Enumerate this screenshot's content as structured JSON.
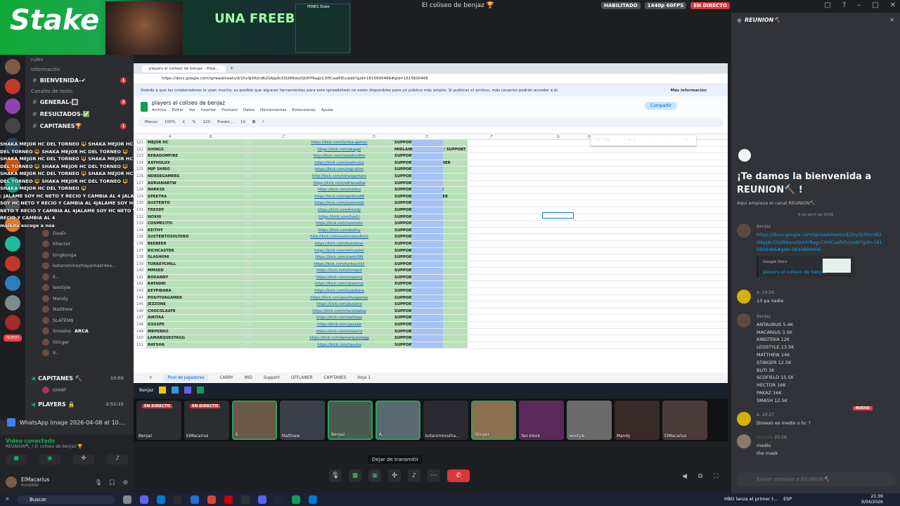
{
  "window": {
    "title": "El coliseo de benjaz 🏆",
    "badges": [
      "HABILITADO",
      "1440p 60FPS",
      "EN DIRECTO"
    ],
    "badge_colors": [
      "#4e5058",
      "#4e5058",
      "#da373c"
    ]
  },
  "banner": {
    "brand": "Stake",
    "promo": "UNA FREEBET",
    "mini_label": "PENES Stake"
  },
  "sidebar": {
    "category_rules": "rules",
    "category_info": "Información",
    "ch_bienvenida": "BIENVENIDA-✔",
    "category_text": "Canales de texto",
    "ch_general": "GENERAL-🔳",
    "ch_resultados": "RESULTADOS-✅",
    "ch_capitanes": "CAPITANES🏆",
    "voice_users": [
      "DaaD-",
      "Khector",
      "kingkonga",
      "kotarominozhayamasr4ev...",
      "K..",
      "leostyle",
      "Mandy",
      "Matthew",
      "SLATEM$",
      "Smasho",
      "Stinger",
      "V.."
    ],
    "smasho_tag": "ARCA",
    "ch_capitanes2": "CAPITANES 🔨",
    "capitanes2_time": "15:55",
    "ghiat": "GHIAT",
    "ch_players": "PLAYERS 🔒",
    "players_time": "2:52:15",
    "new_badge": "NUEVO"
  },
  "overlay_chat": [
    "SHAKA MEJOR HC DEL TORNEO 🔱 SHAKA MEJOR HC",
    "DEL TORNEO 🔱 SHAKA MEJOR HC DEL TORNEO 🔱",
    "SHAKA MEJOR HC DEL TORNEO 🔱 SHAKA MEJOR HC",
    "DEL TORNEO 🔱 SHAKA MEJOR HC DEL TORNEO 🔱",
    "SHAKA MEJOR HC DEL TORNEO 🔱 SHAKA MEJOR HC",
    "DEL TORNEO 🔱 SHAKA MEJOR HC DEL TORNEO 🔱",
    "SHAKA MEJOR HC DEL TORNEO 🔱",
    ": JALAME SOY HC NETO Y RECIO Y CAMBIA AL 4 JALAME",
    "SOY HC NETO Y RECIO Y CAMBIA AL 4JALAME SOY HC",
    "NETO Y RECIO Y CAMBIA AL 4JALAME SOY HC NETO Y",
    "RECIO Y CAMBIA AL 4",
    "maikita escoge a noa"
  ],
  "whatsapp": "WhatsApp Image 2026-04-08 at 10....",
  "voice": {
    "status": "Video conectado",
    "channel": "REUNION🔨 / El coliseo de benjaz 🏆"
  },
  "user": {
    "name": "ElMacarius",
    "status": "Invisible"
  },
  "browser": {
    "tab": "players el coliseo de benjaz - Hoja...",
    "url": "https://docs.google.com/spreadsheets/d/1hy9jXRzrzB2OAJq9c5SQR6oozQUHYRagcCXHCaafH5c/edit?gid=1615600466#gid=1615600466",
    "info": "Debido a que los colaboradores lo usan mucho, es posible que algunas herramientas para este spreadsheet no estén disponibles para un público más amplio. Si publicas el archivo, más usuarios podrán acceder a él.",
    "more_info": "Más información"
  },
  "doc": {
    "title": "players el coliseo de benjaz",
    "menus": [
      "Archivo",
      "Editar",
      "Ver",
      "Insertar",
      "Formato",
      "Datos",
      "Herramientas",
      "Extensiones",
      "Ayuda"
    ],
    "share": "Compartir",
    "toolbar": [
      "Menús",
      "100%",
      "€",
      "%",
      "123",
      "Predet...",
      "10",
      "B",
      "I"
    ],
    "find_query": "LA OGA",
    "find_count": "1 de 1",
    "columns": [
      "A",
      "B",
      "C",
      "D",
      "E",
      "F",
      "G",
      "H"
    ]
  },
  "sheet_rows": [
    {
      "n": "121",
      "name": "MEJOR HC",
      "pts": "3000",
      "link": "https://kick.com/lyrosa-games",
      "role": "SUPPORT"
    },
    {
      "n": "122",
      "name": "SHINGS",
      "pts": "5000",
      "link": "https://kick.com/akagal",
      "role": "MIDLANER / OFFLANER / SUPPORT"
    },
    {
      "n": "123",
      "name": "REBADOMFIRE",
      "pts": "3900",
      "link": "http://kick.com/rebadomfire",
      "role": "SUPPORT"
    },
    {
      "n": "124",
      "name": "XATHULUX",
      "pts": "3900",
      "link": "https://kick.com/xxathulux",
      "role": "SUPPORT 4 / 5 / OFFLANER"
    },
    {
      "n": "125",
      "name": "MJP SHIRO",
      "pts": "3800",
      "link": "https://kick.com/mjp-shiro",
      "role": "SUPPORT 5"
    },
    {
      "n": "126",
      "name": "NDREEGAMERS",
      "pts": "3800",
      "link": "http://kick.com/ndreegamers",
      "role": "SUPPORT"
    },
    {
      "n": "127",
      "name": "ADRIANABTW",
      "pts": "3800",
      "link": "https://kick.com/adrianabtw",
      "role": "SUPPORT 5"
    },
    {
      "n": "128",
      "name": "NARKSS",
      "pts": "3560",
      "link": "https://kick.com/narkss",
      "role": "SUPPORT 5 / OFFLANER"
    },
    {
      "n": "129",
      "name": "SPEKTRA",
      "pts": "3500",
      "link": "https://kick.com/spektra88",
      "role": "SUPPORT 4.5 / OFFLANER"
    },
    {
      "n": "130",
      "name": "SUSTENTO",
      "pts": "3500",
      "link": "https://kick.com/sustentob",
      "role": "SUPPORT 4 / 5"
    },
    {
      "n": "131",
      "name": "TREXDY",
      "pts": "3500",
      "link": "https://kick.com/trexdy",
      "role": "SUPPORT / MID"
    },
    {
      "n": "132",
      "name": "HOXHI",
      "pts": "3500",
      "link": "https://kick.com/hoxhi",
      "role": "SUPPORT"
    },
    {
      "n": "133",
      "name": "COSMECITO",
      "pts": "3500",
      "link": "https://kick.com/cosmetx",
      "role": "SUPPORT"
    },
    {
      "n": "134",
      "name": "KEITHY",
      "pts": "3500",
      "link": "https://kick.com/keithy",
      "role": "SUPPORT"
    },
    {
      "n": "135",
      "name": "SUSTENTOSOLTERO",
      "pts": "3500",
      "link": "http://kick.com/sustentosoltero",
      "role": "SUPPORT"
    },
    {
      "n": "136",
      "name": "BEEBEER",
      "pts": "3400",
      "link": "https://kick.com/beeebeer",
      "role": "SUPPORT 4 / 5"
    },
    {
      "n": "137",
      "name": "RICHCASTER",
      "pts": "3300",
      "link": "https://kick.com/richcaster",
      "role": "SUPPORT 4 / 5"
    },
    {
      "n": "138",
      "name": "SLASH096",
      "pts": "3200",
      "link": "https://kick.com/slash096",
      "role": "SUPPORT 4 / 5"
    },
    {
      "n": "139",
      "name": "TURKEYCHILL",
      "pts": "3100",
      "link": "https://kick.com/turkeychill",
      "role": "SUPPORT"
    },
    {
      "n": "140",
      "name": "MMAED",
      "pts": "3000",
      "link": "https://kick.com/mmaed",
      "role": "SUPPORT 5"
    },
    {
      "n": "141",
      "name": "ROXANNY",
      "pts": "3000",
      "link": "https://kick.com/roxanny",
      "role": "SUPPORT 5"
    },
    {
      "n": "142",
      "name": "RATADRI",
      "pts": "3000",
      "link": "https://kick.com/ratadrixd",
      "role": "SUPPORT"
    },
    {
      "n": "143",
      "name": "KEYPIBARA",
      "pts": "3000",
      "link": "https://kick.com/keypibara",
      "role": "SUPPORT"
    },
    {
      "n": "144",
      "name": "POSITIVAGAMER",
      "pts": "3000",
      "link": "https://kick.com/positivagamer",
      "role": "SUPPORT"
    },
    {
      "n": "145",
      "name": "JEZZONE",
      "pts": "3000",
      "link": "https://kick.com/jezzone",
      "role": "SUPPORT"
    },
    {
      "n": "146",
      "name": "CHOCOLAATE",
      "pts": "3000",
      "link": "https://kick.com/chocolaatee",
      "role": "SUPPORT"
    },
    {
      "n": "147",
      "name": "AWITAA",
      "pts": "2800",
      "link": "https://kick.com/awitaaa",
      "role": "SUPPORT 5"
    },
    {
      "n": "148",
      "name": "GSUSPE",
      "pts": "2700",
      "link": "https://kick.com/gsuspe",
      "role": "SUPPORT"
    },
    {
      "n": "149",
      "name": "MRPERRO",
      "pts": "2700",
      "link": "https://kick.com/mrperro",
      "role": "SUPPORT 4 / 5"
    },
    {
      "n": "150",
      "name": "LAMARQUESTAGG",
      "pts": "2500",
      "link": "https://kick.com/lamarquestagg",
      "role": "SUPPORT 4 / 5"
    },
    {
      "n": "151",
      "name": "RAYSHA",
      "pts": "2500",
      "link": "https://kick.com/raysha",
      "role": "SUPPORT"
    }
  ],
  "sheet_tabs": [
    "Pool de Jugadores",
    "CARRY",
    "MID",
    "Support",
    "OFFLANER",
    "CAPITANES",
    "Hoja 1"
  ],
  "inner_task": {
    "app": "Benjaz"
  },
  "participants": [
    {
      "name": "Benjaz",
      "live": "EN DIRECTO",
      "color": "#2b2d31"
    },
    {
      "name": "ElMacarius",
      "live": "EN DIRECTO",
      "color": "#2b2d31"
    },
    {
      "name": "K",
      "live": "",
      "color": "#6b5848"
    },
    {
      "name": "Matthew",
      "live": "",
      "color": "#3a3f48"
    },
    {
      "name": "Benjaz",
      "live": "",
      "color": "#4a5a52"
    },
    {
      "name": "A.",
      "live": "",
      "color": "#5a6a70"
    },
    {
      "name": "kotarominozha...",
      "live": "",
      "color": "#2a2a30"
    },
    {
      "name": "Stinger",
      "live": "",
      "color": "#8a7050"
    },
    {
      "name": "Yan block",
      "live": "",
      "color": "#5a2a5a"
    },
    {
      "name": "leostyle",
      "live": "",
      "color": "#6a6a6a"
    },
    {
      "name": "Mandy",
      "live": "",
      "color": "#3a2a2a"
    },
    {
      "name": "ElMacarius",
      "live": "",
      "color": "#4a3a3a"
    }
  ],
  "controls": {
    "tooltip": "Dejar de transmitir"
  },
  "chat": {
    "channel": "REUNION🔨",
    "welcome": "¡Te damos la bienvenida a REUNION🔨 !",
    "welcome_sub": "Aquí empieza el canal REUNION🔨.",
    "date": "9 de abril de 2026",
    "msg1_author": "Benjaz",
    "msg1_link": "https://docs.google.com/spreadsheets/d/1hy9jXRzrzB2OAJq9c5SQR6oozQUHYRagcCXHCaafH5c/edit?gid=1615600466#gid=1615600466",
    "embed_site": "Google Docs",
    "embed_title": "players el coliseo de benjaz",
    "msg2_author": "A.",
    "msg2_time": "19:26",
    "msg2_text": "13 pa nadie",
    "msg3_author": "Benjaz",
    "msg3_lines": [
      "ANTAURUS 5.4K",
      "MACARIUS 3.5K",
      "KINGTEKA 12K",
      "LEOSTYLE 13.5K",
      "MATTHEW 14K",
      "STINGER 12.5K",
      "BUTI 3K",
      "SCOFIELD 15.5K",
      "HECTOR 16K",
      "PAKAZ 16K",
      "SMASH 12.5K"
    ],
    "new_label": "NUEVO",
    "msg4_author": "A.",
    "msg4_time": "20:27",
    "msg4_text": "Dosexo es medio o hc ?",
    "msg5_author": "leostyle",
    "msg5_time": "20:28",
    "msg5_lines": [
      "medio",
      "the mask"
    ],
    "input_placeholder": "Enviar mensaje a REUNION🔨"
  },
  "taskbar": {
    "search": "Buscar",
    "news": "HBO lanza el primer t...",
    "lang": "ESP",
    "time": "21:39",
    "date": "9/04/2026"
  }
}
